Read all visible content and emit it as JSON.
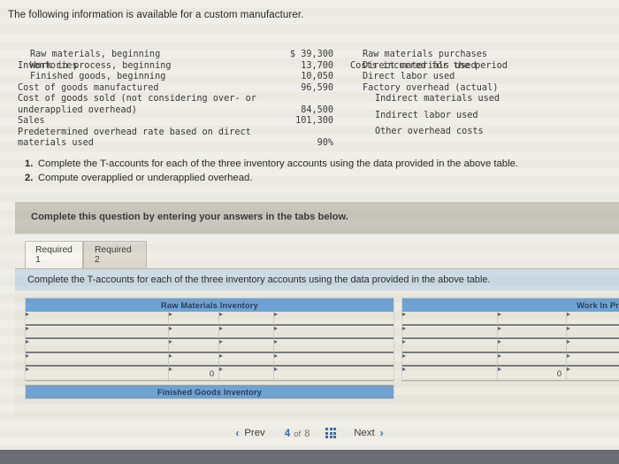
{
  "intro": "The following information is available for a custom manufacturer.",
  "data_table": {
    "left": {
      "heading": "Inventories",
      "rows": [
        {
          "label": "Raw materials, beginning",
          "value": "$ 39,300",
          "indent": 1
        },
        {
          "label": "Work in process, beginning",
          "value": "13,700",
          "indent": 1
        },
        {
          "label": "Finished goods, beginning",
          "value": "10,050",
          "indent": 1
        },
        {
          "label": "Cost of goods manufactured",
          "value": "96,590",
          "indent": 0
        },
        {
          "label": "Cost of goods sold (not considering over- or",
          "value": "",
          "indent": 0
        },
        {
          "label": "underapplied overhead)",
          "value": "84,500",
          "indent": 0
        },
        {
          "label": "Sales",
          "value": "101,300",
          "indent": 0
        },
        {
          "label": "Predetermined overhead rate based on direct",
          "value": "",
          "indent": 0
        },
        {
          "label": "materials used",
          "value": "90%",
          "indent": 0
        }
      ]
    },
    "right": {
      "heading": "Costs incurred for the period",
      "rows": [
        {
          "label": "Raw materials purchases",
          "value": "",
          "indent": 1
        },
        {
          "label": "Direct materials used",
          "value": "",
          "indent": 1
        },
        {
          "label": "Direct labor used",
          "value": "",
          "indent": 1
        },
        {
          "label": "Factory overhead (actual)",
          "value": "",
          "indent": 1
        },
        {
          "label": "Indirect materials used",
          "value": "",
          "indent": 2
        },
        {
          "label": "Indirect labor used",
          "value": "",
          "indent": 2
        },
        {
          "label": "Other overhead costs",
          "value": "",
          "indent": 2
        }
      ]
    }
  },
  "requirements": [
    {
      "num": "1.",
      "text": "Complete the T-accounts for each of the three inventory accounts using the data provided in the above table."
    },
    {
      "num": "2.",
      "text": "Compute overapplied or underapplied overhead."
    }
  ],
  "grey_band": {
    "text": "Complete this question by entering your answers in the tabs below."
  },
  "tabs": [
    {
      "label": "Required 1",
      "active": true
    },
    {
      "label": "Required 2",
      "active": false
    }
  ],
  "sub_instruction": "Complete the T-accounts for each of the three inventory accounts using the data provided in the above table.",
  "accounts": [
    {
      "id": "raw-materials-inventory",
      "title": "Raw Materials Inventory",
      "rows": [
        {
          "c1": "",
          "c2": "",
          "c3": "",
          "c4": "",
          "total": false
        },
        {
          "c1": "",
          "c2": "",
          "c3": "",
          "c4": "",
          "total": false
        },
        {
          "c1": "",
          "c2": "",
          "c3": "",
          "c4": "",
          "total": false
        },
        {
          "c1": "",
          "c2": "",
          "c3": "",
          "c4": "",
          "total": false
        },
        {
          "c1": "",
          "c2": "0",
          "c3": "",
          "c4": "",
          "total": true
        }
      ]
    },
    {
      "id": "work-in-process-inventory",
      "title": "Work In Process Inve",
      "rows": [
        {
          "c1": "",
          "c2": "",
          "c3": "",
          "total": false
        },
        {
          "c1": "",
          "c2": "",
          "c3": "",
          "total": false
        },
        {
          "c1": "",
          "c2": "",
          "c3": "",
          "total": false
        },
        {
          "c1": "",
          "c2": "",
          "c3": "",
          "total": false
        },
        {
          "c1": "",
          "c2": "0",
          "c3": "",
          "total": true
        }
      ]
    },
    {
      "id": "finished-goods-inventory",
      "title": "Finished Goods Inventory",
      "rows": []
    }
  ],
  "nav": {
    "prev_label": "Prev",
    "next_label": "Next",
    "prev_chevron": "‹",
    "next_chevron": "›",
    "current_page": "4",
    "of_label": "of",
    "total_pages": "8",
    "grid_icon": "grid-icon"
  },
  "colors": {
    "header_blue": "#6fa3d4",
    "page_bg": "#efeee8",
    "grey_band": "#c9c6bd",
    "sub_instruction_bg": "#ccdbe6",
    "accent_link": "#3c6fa8",
    "bottom_bar": "#6b6f75"
  }
}
